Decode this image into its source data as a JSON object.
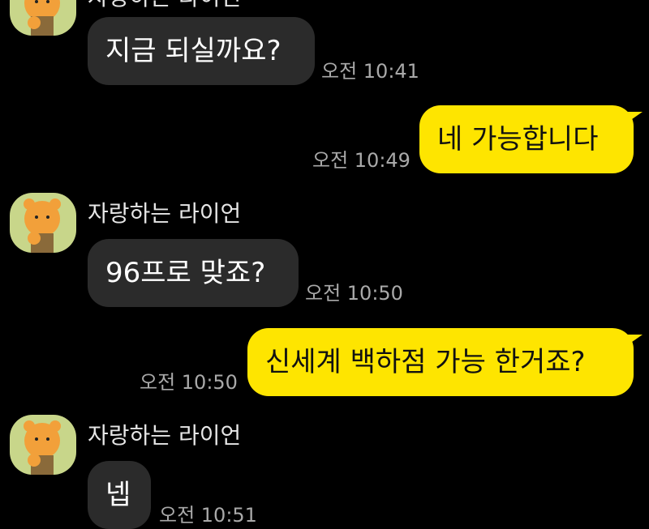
{
  "chat": {
    "partner_name": "자랑하는 라이언",
    "messages": [
      {
        "side": "in",
        "text": "지금 되실까요?",
        "time": "오전 10:41"
      },
      {
        "side": "out",
        "text": "네 가능합니다",
        "time": "오전 10:49"
      },
      {
        "side": "in",
        "sender": "자랑하는 라이언",
        "text": "96프로 맞죠?",
        "time": "오전 10:50"
      },
      {
        "side": "out",
        "text": "신세계 백하점  가능 한거죠?",
        "time": "오전 10:50"
      },
      {
        "side": "in",
        "sender": "자랑하는 라이언",
        "text": "넵",
        "time": "오전 10:51"
      }
    ]
  },
  "colors": {
    "background": "#000000",
    "incoming_bubble": "#2b2b2b",
    "outgoing_bubble": "#fee500",
    "avatar_bg": "#c8d68a"
  },
  "icons": {
    "avatar": "ryan-profile-icon"
  }
}
